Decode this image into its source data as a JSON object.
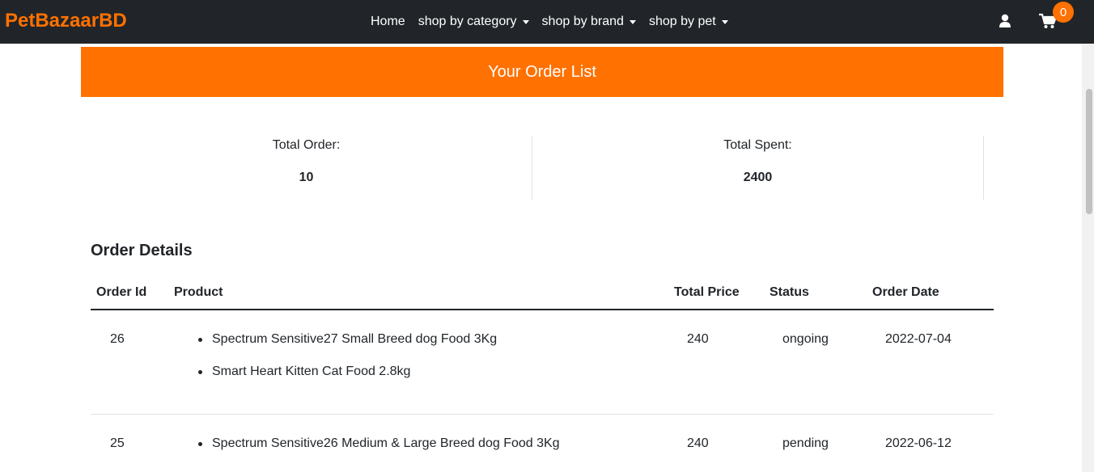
{
  "navbar": {
    "brand": "PetBazaarBD",
    "links": [
      "Home",
      "shop by category",
      "shop by brand",
      "shop by pet"
    ],
    "cart_count": "0",
    "icons": {
      "user": "user-icon",
      "cart": "cart-icon"
    },
    "colors": {
      "background": "#212529",
      "brand": "#ff7100",
      "badge": "#ff7100"
    }
  },
  "banner": {
    "title": "Your Order List",
    "color": "#ff7100"
  },
  "summary": {
    "total_order_label": "Total Order:",
    "total_order_value": "10",
    "total_spent_label": "Total Spent:",
    "total_spent_value": "2400"
  },
  "orders": {
    "title": "Order Details",
    "columns": [
      "Order Id",
      "Product",
      "Total Price",
      "Status",
      "Order Date"
    ],
    "rows": [
      {
        "id": "26",
        "products": [
          "Spectrum Sensitive27 Small Breed dog Food 3Kg",
          "Smart Heart Kitten Cat Food 2.8kg"
        ],
        "price": "240",
        "status": "ongoing",
        "date": "2022-07-04"
      },
      {
        "id": "25",
        "products": [
          "Spectrum Sensitive26 Medium & Large Breed dog Food 3Kg"
        ],
        "price": "240",
        "status": "pending",
        "date": "2022-06-12"
      }
    ]
  }
}
